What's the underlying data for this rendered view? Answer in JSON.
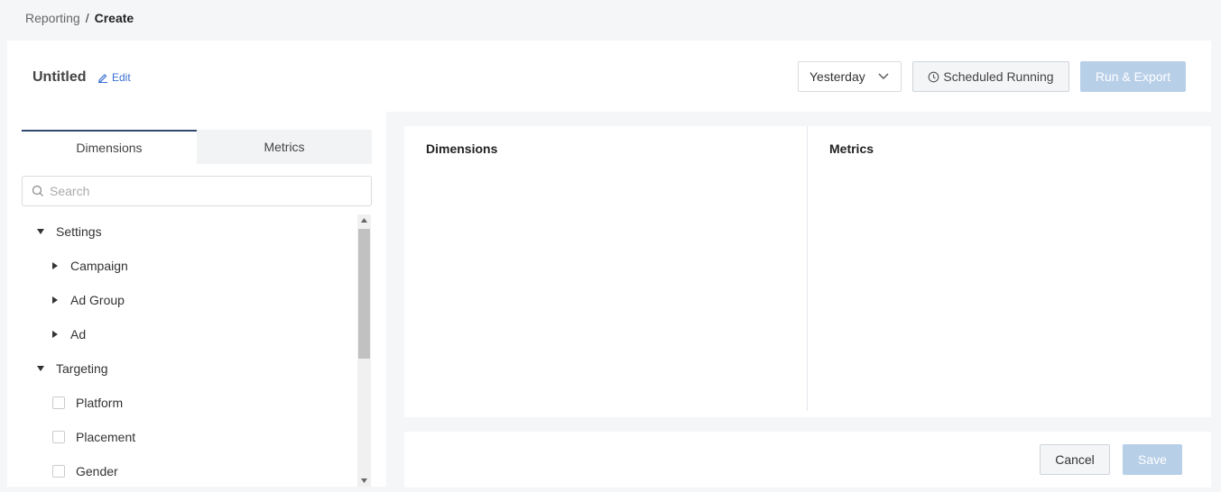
{
  "breadcrumb": {
    "parent": "Reporting",
    "separator": "/",
    "current": "Create"
  },
  "header": {
    "title": "Untitled",
    "edit_label": "Edit",
    "date_range": "Yesterday",
    "scheduled_label": "Scheduled Running",
    "run_label": "Run & Export"
  },
  "left": {
    "tabs": [
      {
        "label": "Dimensions"
      },
      {
        "label": "Metrics"
      }
    ],
    "search_placeholder": "Search",
    "tree": {
      "settings": "Settings",
      "campaign": "Campaign",
      "ad_group": "Ad Group",
      "ad": "Ad",
      "targeting": "Targeting",
      "platform": "Platform",
      "placement": "Placement",
      "gender": "Gender"
    }
  },
  "right": {
    "dimensions_title": "Dimensions",
    "metrics_title": "Metrics"
  },
  "footer": {
    "cancel_label": "Cancel",
    "save_label": "Save"
  },
  "colors": {
    "primary_disabled": "#b8cfe8",
    "tab_accent": "#2f4a6e",
    "link": "#3a6fd0"
  }
}
